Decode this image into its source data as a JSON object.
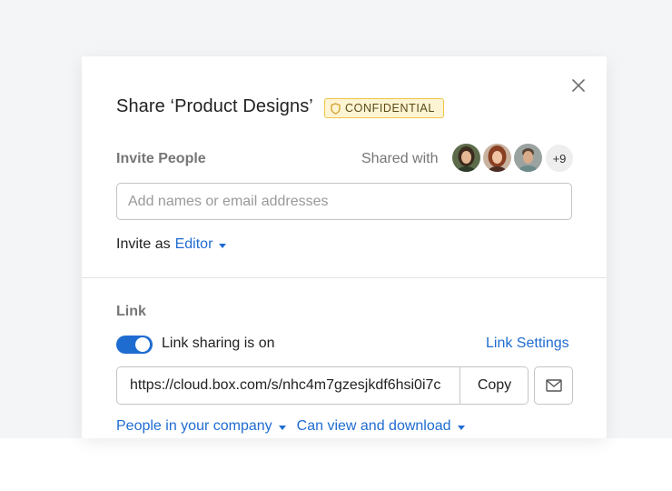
{
  "modal": {
    "title": "Share ‘Product Designs’",
    "badge": "CONFIDENTIAL",
    "close_icon": "close-icon"
  },
  "invite": {
    "label": "Invite People",
    "shared_with_label": "Shared with",
    "more_count": "+9",
    "input_placeholder": "Add names or email addresses",
    "invite_as_label": "Invite as",
    "role": "Editor"
  },
  "link": {
    "label": "Link",
    "toggle_on": true,
    "toggle_text": "Link sharing is on",
    "settings_label": "Link Settings",
    "url": "https://cloud.box.com/s/nhc4m7gzesjkdf6hsi0i7c",
    "copy_label": "Copy",
    "audience": "People in your company",
    "permission": "Can view and download"
  },
  "colors": {
    "accent": "#1f6cd1",
    "badge_bg": "#fdf4d3",
    "badge_border": "#f0c44a"
  }
}
